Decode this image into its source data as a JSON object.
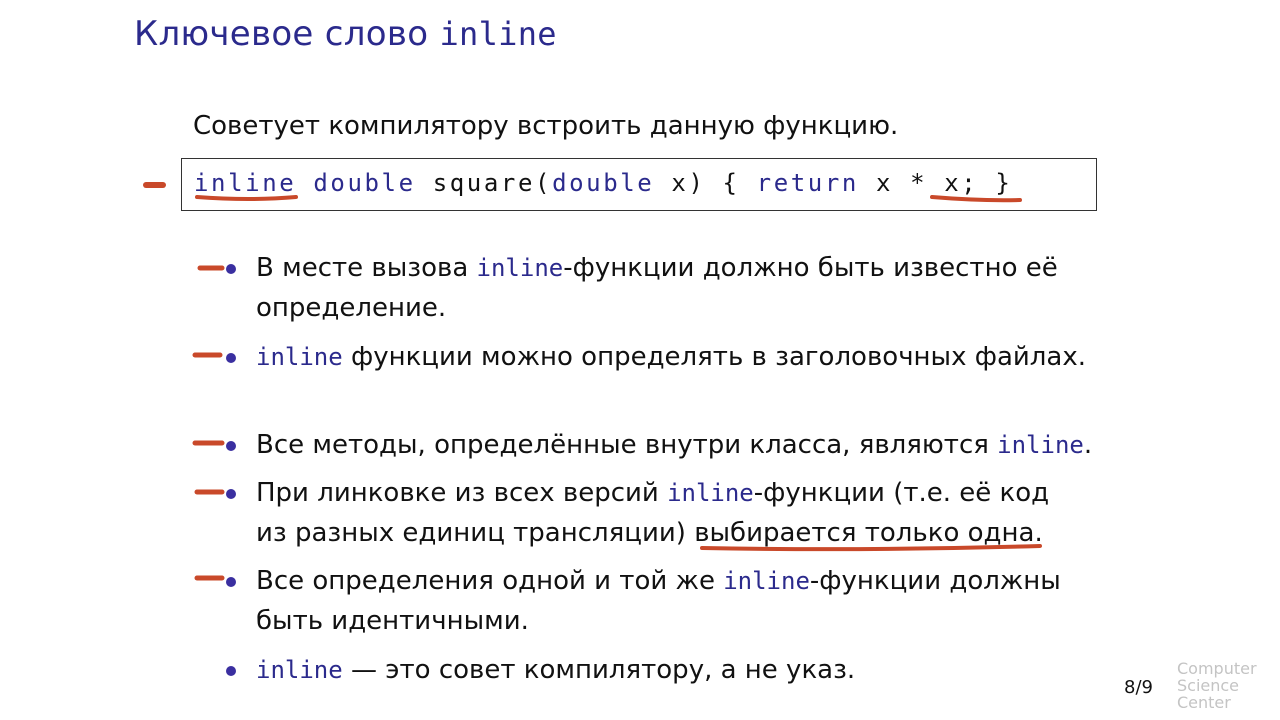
{
  "slide": {
    "title_text": "Ключевое слово ",
    "title_code": "inline",
    "intro": "Советует компилятору встроить данную функцию.",
    "code": {
      "kw1": "inline",
      "sp1": " ",
      "kw2": "double",
      "mid1": " square(",
      "kw3": "double",
      "mid2": " x) { ",
      "kw4": "return",
      "tail": " x * x; }"
    },
    "bullets": [
      {
        "pre": "В месте вызова ",
        "code": "inline",
        "post": "-функции должно быть известно её определение."
      },
      {
        "pre": "",
        "code": "inline",
        "post": " функции можно определять в заголовочных файлах."
      },
      {
        "pre": "Все методы, определённые внутри класса, являются ",
        "code": "inline",
        "post": "."
      },
      {
        "pre": "При линковке из всех версий ",
        "code": "inline",
        "post": "-функции (т.е. её код из разных единиц трансляции) выбирается только одна."
      },
      {
        "pre": "Все определения одной и той же ",
        "code": "inline",
        "post": "-функции должны быть идентичными."
      },
      {
        "pre": "",
        "code": "inline",
        "post": " — это совет компилятору, а не указ."
      }
    ],
    "page_number": "8/9",
    "logo": [
      "Computer",
      "Science",
      "Center"
    ]
  },
  "colors": {
    "accent": "#2b2a8c",
    "annotation": "#c9492a",
    "logo": "#c4c4c4"
  }
}
